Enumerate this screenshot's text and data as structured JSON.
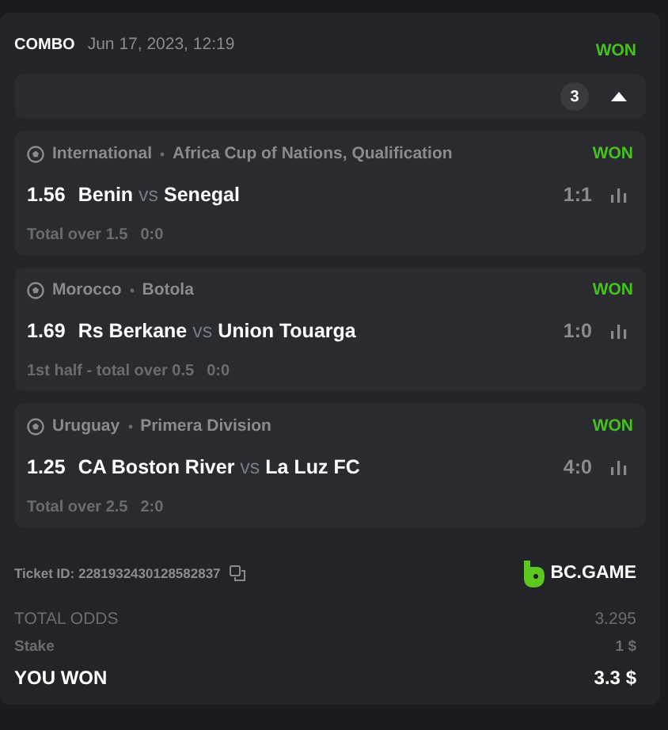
{
  "header": {
    "type": "COMBO",
    "date": "Jun 17, 2023, 12:19",
    "status": "WON"
  },
  "legs_bar": {
    "count": "3",
    "expanded": true
  },
  "legs": [
    {
      "country": "International",
      "league": "Africa Cup of Nations, Qualification",
      "status": "WON",
      "odds": "1.56",
      "home": "Benin",
      "vs": "vs",
      "away": "Senegal",
      "score": "1:1",
      "market": "Total over 1.5",
      "market_score": "0:0"
    },
    {
      "country": "Morocco",
      "league": "Botola",
      "status": "WON",
      "odds": "1.69",
      "home": "Rs Berkane",
      "vs": "vs",
      "away": "Union Touarga",
      "score": "1:0",
      "market": "1st half - total over 0.5",
      "market_score": "0:0"
    },
    {
      "country": "Uruguay",
      "league": "Primera Division",
      "status": "WON",
      "odds": "1.25",
      "home": "CA Boston River",
      "vs": "vs",
      "away": "La Luz FC",
      "score": "4:0",
      "market": "Total over 2.5",
      "market_score": "2:0"
    }
  ],
  "ticket": {
    "label": "Ticket ID: 2281932430128582837",
    "brand": "BC.GAME"
  },
  "summary": [
    {
      "kind": "muted",
      "label": "TOTAL ODDS",
      "value": "3.295"
    },
    {
      "kind": "small",
      "label": "Stake",
      "value": "1 $"
    },
    {
      "kind": "total",
      "label": "YOU WON",
      "value": "3.3 $"
    }
  ]
}
